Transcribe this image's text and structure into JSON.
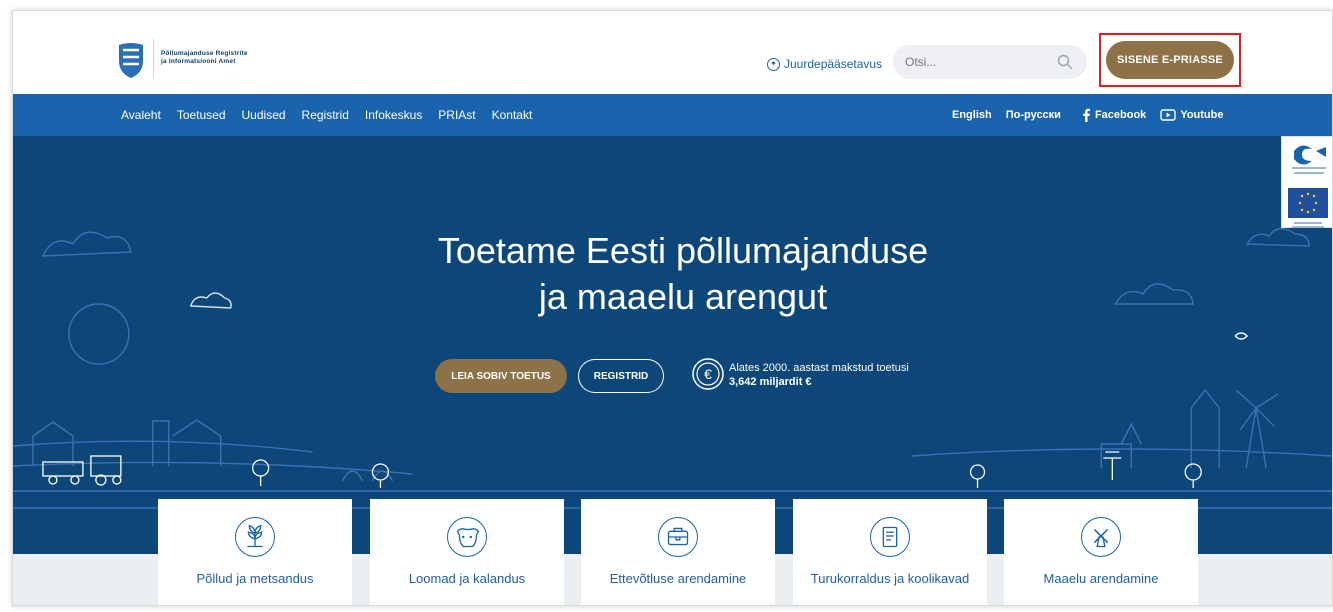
{
  "header": {
    "logo_line1": "Põllumajanduse Registrite",
    "logo_line2": "ja Informatsiooni Amet",
    "accessibility_label": "Juurdepääsetavus",
    "search_placeholder": "Otsi...",
    "login_button": "SISENE E-PRIASSE",
    "highlight_color": "#e31b23"
  },
  "nav": {
    "items": [
      "Avaleht",
      "Toetused",
      "Uudised",
      "Registrid",
      "Infokeskus",
      "PRIAst",
      "Kontakt"
    ],
    "english": "English",
    "russian": "По-русски",
    "facebook": "Facebook",
    "youtube": "Youtube"
  },
  "hero": {
    "title_line1": "Toetame Eesti põllumajanduse",
    "title_line2": "ja maaelu arengut",
    "find_support_button": "LEIA SOBIV TOETUS",
    "registers_button": "REGISTRID",
    "stat_label": "Alates 2000. aastast makstud toetusi",
    "stat_value": "3,642 miljardit €"
  },
  "cards": [
    {
      "label": "Põllud ja metsandus",
      "icon": "wheat-icon"
    },
    {
      "label": "Loomad ja kalandus",
      "icon": "cow-icon"
    },
    {
      "label": "Ettevõtluse arendamine",
      "icon": "briefcase-icon"
    },
    {
      "label": "Turukorraldus ja koolikavad",
      "icon": "document-icon"
    },
    {
      "label": "Maaelu arendamine",
      "icon": "windmill-icon"
    }
  ],
  "colors": {
    "nav_blue": "#1a63ad",
    "hero_blue": "#0d4678",
    "gold": "#8d7148"
  }
}
